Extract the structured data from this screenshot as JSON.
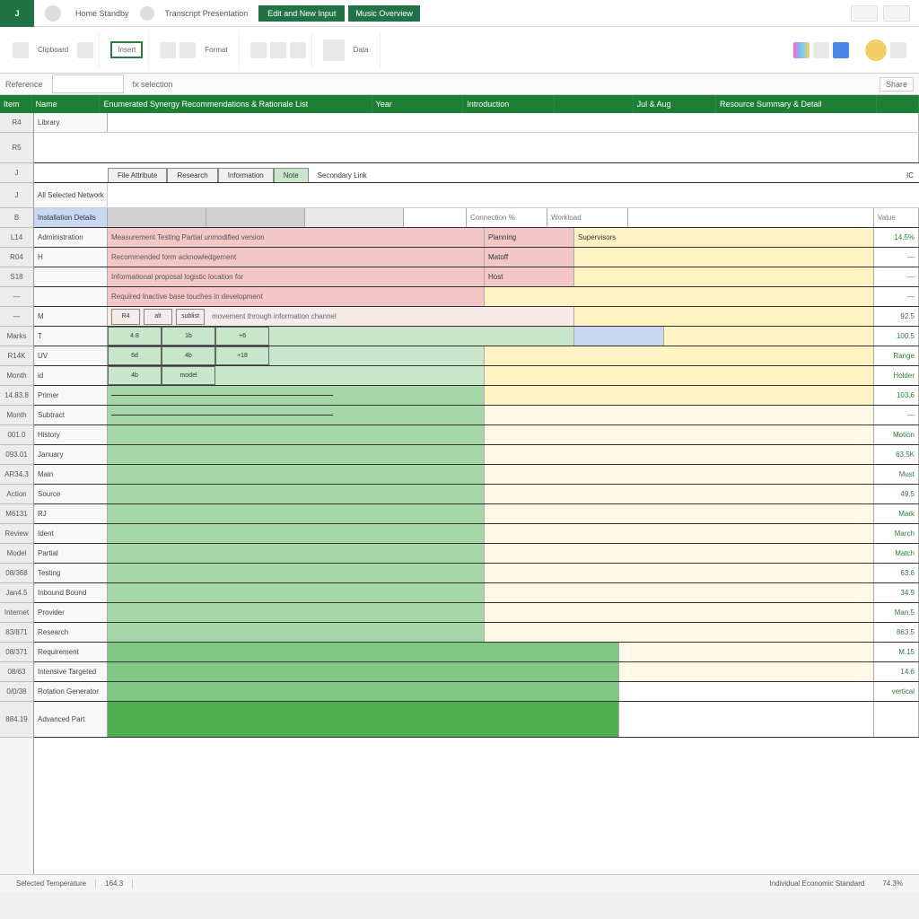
{
  "titlebar": {
    "app_glyph": "J",
    "segments": [
      "Home Standby",
      "Transcript Presentation",
      "Edit and New Input",
      "Music Overview"
    ],
    "active_index": 2
  },
  "ribbon": {
    "groups": [
      {
        "label": "Clipboard"
      },
      {
        "label": "Insert",
        "boxed": true
      },
      {
        "label": "Format"
      },
      {
        "label": "Data"
      }
    ]
  },
  "formula_bar": {
    "name_box": "Reference",
    "namebox_value": "",
    "fx": "fx selection",
    "right": "Share"
  },
  "column_headers": [
    "Item",
    "Name",
    "Enumerated Synergy Recommendations & Rationale List",
    "Year",
    "Introduction",
    "",
    "Jul & Aug",
    "Resource Summary & Detail"
  ],
  "top_rows": {
    "r1": {
      "hdr": "R4",
      "a": "Library"
    },
    "r2": {
      "hdr": "R5"
    },
    "r3": {
      "hdr": "J"
    }
  },
  "tabs": [
    "File Attribute",
    "Research",
    "Information",
    "Note",
    "Secondary Link"
  ],
  "tabs_right": "IC",
  "section_title": {
    "hdr": "J",
    "text": "All Selected Network"
  },
  "header_row": {
    "hdr": "B",
    "a": "Installation Details",
    "g": "Connection %",
    "h": "Workload",
    "j": "Value"
  },
  "rows": [
    {
      "hdr": "L14",
      "a": "Administration",
      "desc": "Measurement Testing Partial unmodified version",
      "e": "Planning",
      "i": "Supervisors",
      "j": "14.5%",
      "fillL": "pink",
      "fillR": "yellow"
    },
    {
      "hdr": "R04",
      "a": "H",
      "desc": "Recommended form acknowledgement",
      "e": "Matoff",
      "j": "—",
      "fillL": "pink",
      "fillR": "yellow"
    },
    {
      "hdr": "S18",
      "a": "",
      "desc": "Informational proposal logistic location for",
      "e": "Host",
      "j": "—",
      "fillL": "pink",
      "fillR": "yellow"
    },
    {
      "hdr": "—",
      "a": "",
      "desc": "Required Inactive base touches in development",
      "e": "",
      "j": "—",
      "fillL": "pink",
      "fillR": "yellow"
    },
    {
      "hdr": "—",
      "a": "M",
      "subhdr": true,
      "cells": [
        "R4",
        "alt",
        "sublist",
        "movement through information channel"
      ],
      "j": "92.5",
      "fillR": "yellow"
    },
    {
      "hdr": "Marks",
      "a": "T",
      "mini": [
        "4.8",
        "1b",
        "+6"
      ],
      "j": "100.5",
      "fillL": "green1",
      "fillR": "yellow",
      "blueEnd": true
    },
    {
      "hdr": "R14K",
      "a": "UV",
      "mini": [
        "6d",
        "4b",
        "+18"
      ],
      "j": "Range",
      "fillL": "green1",
      "fillR": "yellow"
    },
    {
      "hdr": "Month",
      "a": "id",
      "mini": [
        "4b",
        "model"
      ],
      "j": "Holder",
      "fillL": "green1",
      "fillR": "yellow"
    },
    {
      "hdr": "14.83.8",
      "a": "Primer",
      "line": true,
      "j": "103.6",
      "fillL": "green2",
      "fillR": "yellow"
    },
    {
      "hdr": "Month",
      "a": "Subtract",
      "line": true,
      "j": "—",
      "fillL": "green2",
      "fillR": "cream"
    },
    {
      "hdr": "001.0",
      "a": "History",
      "j": "Motion",
      "fillL": "green2",
      "fillR": "cream"
    },
    {
      "hdr": "093.01",
      "a": "January",
      "j": "63.5K",
      "fillL": "green2",
      "fillR": "cream"
    },
    {
      "hdr": "AR34.3",
      "a": "Main",
      "j": "Must",
      "fillL": "green2",
      "fillR": "cream"
    },
    {
      "hdr": "Action",
      "a": "Source",
      "j": "49.5",
      "fillL": "green2",
      "fillR": "cream"
    },
    {
      "hdr": "M6131",
      "a": "RJ",
      "j": "Mark",
      "fillL": "green2",
      "fillR": "cream"
    },
    {
      "hdr": "Review",
      "a": "Ident",
      "j": "March",
      "fillL": "green2",
      "fillR": "cream"
    },
    {
      "hdr": "Model",
      "a": "Partial",
      "j": "Match",
      "fillL": "green2",
      "fillR": "cream"
    },
    {
      "hdr": "08/368",
      "a": "Testing",
      "j": "63.6",
      "fillL": "green2",
      "fillR": "cream"
    },
    {
      "hdr": "Jan4.5",
      "a": "Inbound Bound",
      "j": "34.9",
      "fillL": "green2",
      "fillR": "cream"
    },
    {
      "hdr": "Internet",
      "a": "Provider",
      "j": "Man.5",
      "fillL": "green2",
      "fillR": "cream"
    },
    {
      "hdr": "83/871",
      "a": "Research",
      "j": "863.5",
      "fillL": "green2",
      "fillR": "cream"
    },
    {
      "hdr": "08/371",
      "a": "Requirement",
      "j": "M.15",
      "fillL": "green3",
      "fillR": "cream",
      "wider": true
    },
    {
      "hdr": "08/63",
      "a": "Intensive Targeted",
      "j": "14.6",
      "fillL": "green3",
      "fillR": "cream",
      "wider": true
    },
    {
      "hdr": "0/0/38",
      "a": "Rotation Generator",
      "j": "vertical",
      "fillL": "green3",
      "fillR": "white",
      "wider": true
    },
    {
      "hdr": "884.19",
      "a": "Advanced Part",
      "j": "",
      "fillL": "green4",
      "fillR": "white",
      "wider": true,
      "tall": true
    }
  ],
  "status": {
    "left": "Selected Temperature",
    "mid": "164.3",
    "right1": "Individual Economic Standard",
    "right2": "74.3%"
  }
}
